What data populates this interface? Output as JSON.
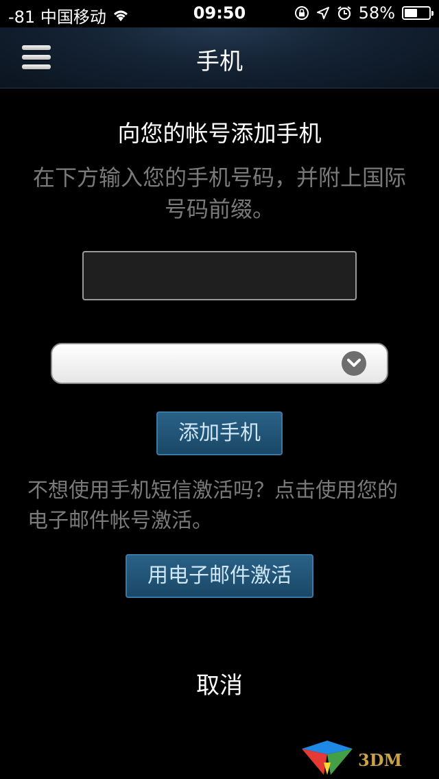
{
  "status_bar": {
    "carrier": "-81 中国移动",
    "time": "09:50",
    "battery_percent": "58%",
    "battery_level": 0.58,
    "icons": [
      "wifi-icon",
      "rotation-lock-icon",
      "location-icon",
      "alarm-icon",
      "battery-icon"
    ]
  },
  "nav": {
    "title": "手机",
    "menu_icon": "hamburger-menu-icon"
  },
  "main": {
    "heading": "向您的帐号添加手机",
    "instructions": "在下方输入您的手机号码，并附上国际号码前缀。",
    "phone_input": {
      "value": "",
      "placeholder": ""
    },
    "country_select": {
      "selected": ""
    },
    "add_phone_label": "添加手机",
    "alt_text": "不想使用手机短信激活吗？点击使用您的电子邮件帐号激活。",
    "email_activate_label": "用电子邮件激活",
    "cancel_label": "取消"
  },
  "watermark": {
    "text": "3DM",
    "colors": {
      "red": "#e53935",
      "blue": "#1e88e5",
      "green": "#43a047",
      "yellow": "#fdd835"
    }
  },
  "colors": {
    "button_fill": "#1f5475",
    "button_text": "#cfe7f7",
    "muted_text": "#7a7a7a"
  }
}
